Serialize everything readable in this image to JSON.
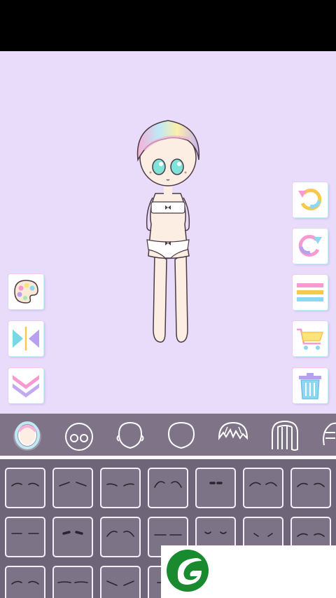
{
  "game": {
    "screen": "dress-up-editor",
    "selected_category": "face-shape",
    "stage_background_color": "#e9dcfb"
  },
  "left_tools": [
    {
      "name": "palette-button",
      "icon": "palette-icon"
    },
    {
      "name": "flip-button",
      "icon": "mirror-flip-icon"
    },
    {
      "name": "collapse-button",
      "icon": "double-chevron-down-icon"
    }
  ],
  "right_tools": [
    {
      "name": "undo-button",
      "icon": "undo-arrow-icon"
    },
    {
      "name": "redo-button",
      "icon": "redo-arrow-icon"
    },
    {
      "name": "layers-menu-button",
      "icon": "stripes-menu-icon"
    },
    {
      "name": "shop-button",
      "icon": "shopping-cart-icon"
    },
    {
      "name": "delete-button",
      "icon": "trash-can-icon"
    }
  ],
  "categories": [
    {
      "name": "category-face-color",
      "icon": "face-color-icon",
      "selected": true
    },
    {
      "name": "category-eyes",
      "icon": "eyes-face-icon",
      "selected": false
    },
    {
      "name": "category-ears",
      "icon": "face-ears-icon",
      "selected": false
    },
    {
      "name": "category-head",
      "icon": "head-outline-icon",
      "selected": false
    },
    {
      "name": "category-bangs",
      "icon": "bangs-hair-icon",
      "selected": false
    },
    {
      "name": "category-long-hair",
      "icon": "long-hair-icon",
      "selected": false
    },
    {
      "name": "category-more",
      "icon": "hair-partial-icon",
      "selected": false
    }
  ],
  "eyebrow_options": [
    {
      "style": "soft-arch"
    },
    {
      "style": "angled"
    },
    {
      "style": "raised"
    },
    {
      "style": "high-arch"
    },
    {
      "style": "dot"
    },
    {
      "style": "wide-arch"
    },
    {
      "style": "thin-arch"
    },
    {
      "style": "flat"
    },
    {
      "style": "bold-dash"
    },
    {
      "style": "curved"
    },
    {
      "style": "straight"
    },
    {
      "style": "tiny-curve"
    },
    {
      "style": "small-dip"
    },
    {
      "style": "low-arch"
    },
    {
      "style": "soft-arch-2"
    },
    {
      "style": "long-flat"
    },
    {
      "style": "slanted"
    },
    {
      "style": "tiny-dash"
    }
  ],
  "ad_banner": {
    "icon": "green-leaf-logo-icon",
    "color": "#1a8a2e"
  }
}
